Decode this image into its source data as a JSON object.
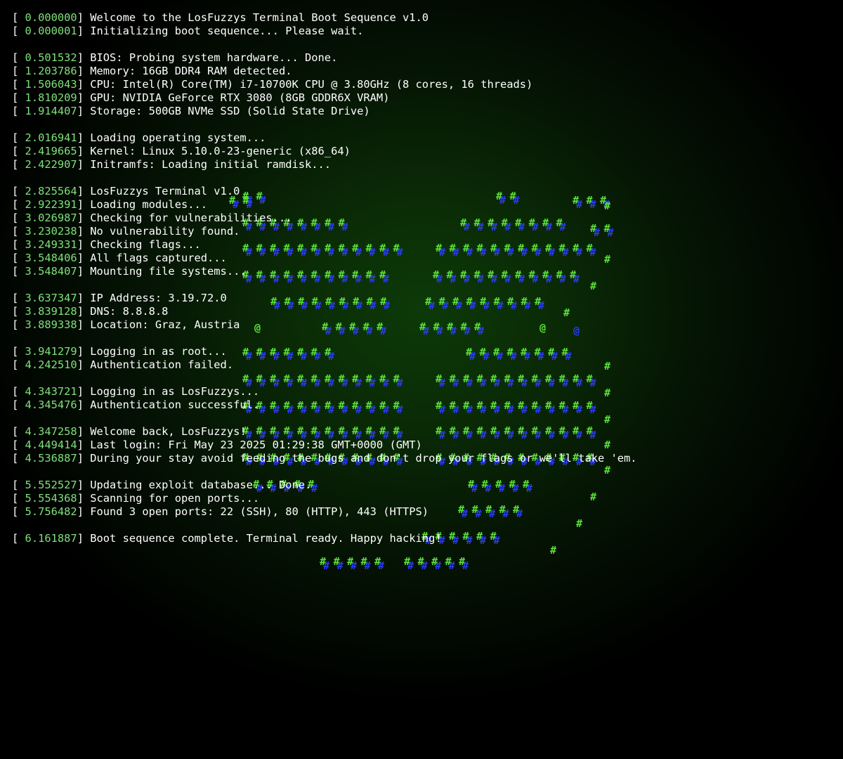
{
  "terminal": {
    "log": [
      {
        "ts": "0.000000",
        "text": "Welcome to the LosFuzzys Terminal Boot Sequence v1.0"
      },
      {
        "ts": "0.000001",
        "text": "Initializing boot sequence... Please wait."
      },
      null,
      {
        "ts": "0.501532",
        "text": "BIOS: Probing system hardware... Done."
      },
      {
        "ts": "1.203786",
        "text": "Memory: 16GB DDR4 RAM detected."
      },
      {
        "ts": "1.506043",
        "text": "CPU: Intel(R) Core(TM) i7-10700K CPU @ 3.80GHz (8 cores, 16 threads)"
      },
      {
        "ts": "1.810209",
        "text": "GPU: NVIDIA GeForce RTX 3080 (8GB GDDR6X VRAM)"
      },
      {
        "ts": "1.914407",
        "text": "Storage: 500GB NVMe SSD (Solid State Drive)"
      },
      null,
      {
        "ts": "2.016941",
        "text": "Loading operating system..."
      },
      {
        "ts": "2.419665",
        "text": "Kernel: Linux 5.10.0-23-generic (x86_64)"
      },
      {
        "ts": "2.422907",
        "text": "Initramfs: Loading initial ramdisk..."
      },
      null,
      {
        "ts": "2.825564",
        "text": "LosFuzzys Terminal v1.0"
      },
      {
        "ts": "2.922391",
        "text": "Loading modules..."
      },
      {
        "ts": "3.026987",
        "text": "Checking for vulnerabilities..."
      },
      {
        "ts": "3.230238",
        "text": "No vulnerability found."
      },
      {
        "ts": "3.249331",
        "text": "Checking flags..."
      },
      {
        "ts": "3.548406",
        "text": "All flags captured..."
      },
      {
        "ts": "3.548407",
        "text": "Mounting file systems..."
      },
      null,
      {
        "ts": "3.637347",
        "text": "IP Address: 3.19.72.0"
      },
      {
        "ts": "3.839128",
        "text": "DNS: 8.8.8.8"
      },
      {
        "ts": "3.889338",
        "text": "Location: Graz, Austria"
      },
      null,
      {
        "ts": "3.941279",
        "text": "Logging in as root..."
      },
      {
        "ts": "4.242510",
        "text": "Authentication failed."
      },
      null,
      {
        "ts": "4.343721",
        "text": "Logging in as LosFuzzys..."
      },
      {
        "ts": "4.345476",
        "text": "Authentication successful."
      },
      null,
      {
        "ts": "4.347258",
        "text": "Welcome back, LosFuzzys!"
      },
      {
        "ts": "4.449414",
        "text": "Last login: Fri May 23 2025 01:29:38 GMT+0000 (GMT)"
      },
      {
        "ts": "4.536887",
        "text": "During your stay avoid feeding the bugs and don't drop your flags or we'll take 'em."
      },
      null,
      {
        "ts": "5.552527",
        "text": "Updating exploit database... Done."
      },
      {
        "ts": "5.554368",
        "text": "Scanning for open ports..."
      },
      {
        "ts": "5.756482",
        "text": "Found 3 open ports: 22 (SSH), 80 (HTTP), 443 (HTTPS)"
      },
      null,
      {
        "ts": "6.161887",
        "text": "Boot sequence complete. Terminal ready. Happy hacking!"
      }
    ]
  },
  "ascii_art": {
    "glyph_main": "#",
    "eye_left": "@",
    "eye_right": "@",
    "colors": {
      "green": "#5ce03a",
      "blue": "#2a3cf0"
    }
  },
  "theme": {
    "timestamp_color": "#7fe07a",
    "text_color": "#ffffff",
    "background": "#000000"
  }
}
